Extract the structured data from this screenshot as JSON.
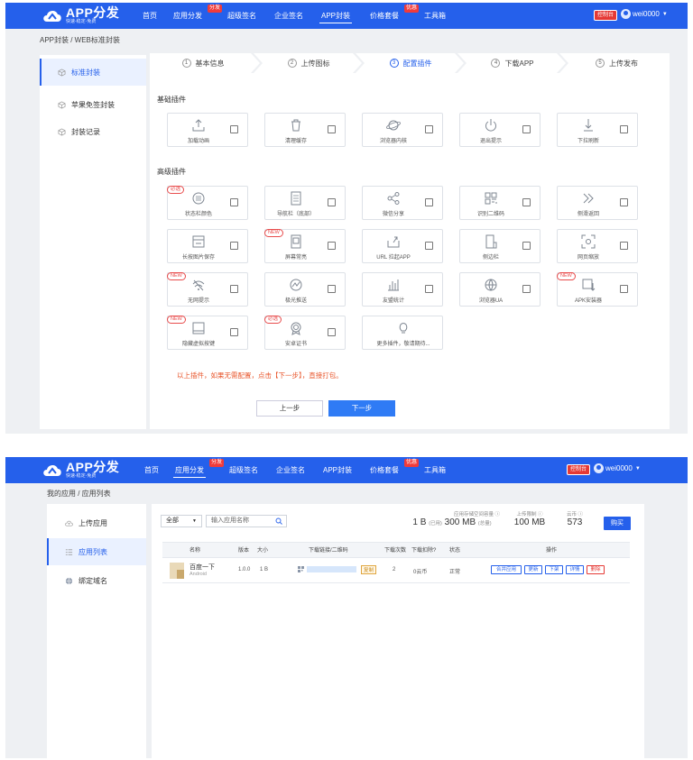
{
  "screen1": {
    "header": {
      "logo_title": "APP分发",
      "logo_sub": "快速-稳定-免费",
      "nav": [
        {
          "label": "首页",
          "tag": ""
        },
        {
          "label": "应用分发",
          "tag": "分发"
        },
        {
          "label": "超级签名",
          "tag": ""
        },
        {
          "label": "企业签名",
          "tag": ""
        },
        {
          "label": "APP封装",
          "tag": ""
        },
        {
          "label": "价格套餐",
          "tag": "优惠"
        },
        {
          "label": "工具箱",
          "tag": ""
        }
      ],
      "active_nav": "APP封装",
      "control_label": "控制台",
      "username": "wei0000"
    },
    "breadcrumb": "APP封装 / WEB标准封装",
    "sidebar": [
      {
        "label": "标准封装",
        "icon": "package-icon"
      },
      {
        "label": "苹果免签封装",
        "icon": "package-icon"
      },
      {
        "label": "封装记录",
        "icon": "package-icon"
      }
    ],
    "steps": [
      {
        "num": "1",
        "label": "基本信息"
      },
      {
        "num": "2",
        "label": "上传图标"
      },
      {
        "num": "3",
        "label": "配置插件"
      },
      {
        "num": "4",
        "label": "下载APP"
      },
      {
        "num": "5",
        "label": "上传发布"
      }
    ],
    "active_step": "3",
    "basic_title": "基础插件",
    "basic_plugins": [
      {
        "label": "加载动画",
        "icon": "upload-icon"
      },
      {
        "label": "清理缓存",
        "icon": "trash-icon"
      },
      {
        "label": "浏览器内核",
        "icon": "planet-icon"
      },
      {
        "label": "退出提示",
        "icon": "power-icon"
      },
      {
        "label": "下拉刷新",
        "icon": "pull-down-icon"
      }
    ],
    "advanced_title": "高级插件",
    "advanced_plugins": [
      {
        "label": "状态栏颜色",
        "icon": "menu-circle-icon",
        "badge": "必选"
      },
      {
        "label": "导航栏（底部）",
        "icon": "document-icon",
        "badge": ""
      },
      {
        "label": "微信分享",
        "icon": "share-icon",
        "badge": ""
      },
      {
        "label": "识别二维码",
        "icon": "qrcode-icon",
        "badge": ""
      },
      {
        "label": "侧滑返回",
        "icon": "double-chevron-icon",
        "badge": ""
      },
      {
        "label": "长按图片保存",
        "icon": "save-image-icon",
        "badge": ""
      },
      {
        "label": "屏幕常亮",
        "icon": "screen-icon",
        "badge": "NEW"
      },
      {
        "label": "URL 拉起APP",
        "icon": "launch-icon",
        "badge": ""
      },
      {
        "label": "侧边栏",
        "icon": "sidebar-icon",
        "badge": ""
      },
      {
        "label": "网页缩放",
        "icon": "zoom-icon",
        "badge": ""
      },
      {
        "label": "无网提示",
        "icon": "wifi-off-icon",
        "badge": "NEW"
      },
      {
        "label": "极光推送",
        "icon": "push-icon",
        "badge": ""
      },
      {
        "label": "友盟统计",
        "icon": "bar-stats-icon",
        "badge": ""
      },
      {
        "label": "浏览器UA",
        "icon": "globe-icon",
        "badge": ""
      },
      {
        "label": "APK安装器",
        "icon": "apk-icon",
        "badge": "NEW"
      },
      {
        "label": "隐藏虚拟按键",
        "icon": "phone-icon",
        "badge": "NEW"
      },
      {
        "label": "安卓证书",
        "icon": "certificate-icon",
        "badge": "必选"
      },
      {
        "label": "更多插件，敬请期待...",
        "icon": "bulb-icon",
        "badge": ""
      }
    ],
    "note": "以上插件，如果无需配置，点击【下一步】，直接打包。",
    "prev_label": "上一步",
    "next_label": "下一步"
  },
  "screen2": {
    "header": {
      "logo_title": "APP分发",
      "logo_sub": "快速-稳定-免费",
      "nav": [
        {
          "label": "首页",
          "tag": ""
        },
        {
          "label": "应用分发",
          "tag": "分发"
        },
        {
          "label": "超级签名",
          "tag": ""
        },
        {
          "label": "企业签名",
          "tag": ""
        },
        {
          "label": "APP封装",
          "tag": ""
        },
        {
          "label": "价格套餐",
          "tag": "优惠"
        },
        {
          "label": "工具箱",
          "tag": ""
        }
      ],
      "active_nav": "应用分发",
      "control_label": "控制台",
      "username": "wei0000"
    },
    "breadcrumb": "我的应用 / 应用列表",
    "sidebar": [
      {
        "label": "上传应用",
        "icon": "cloud-upload-icon"
      },
      {
        "label": "应用列表",
        "icon": "grid-list-icon"
      },
      {
        "label": "绑定域名",
        "icon": "globe-icon"
      }
    ],
    "filter": {
      "select_value": "全部",
      "search_placeholder": "输入应用名称"
    },
    "stats": [
      {
        "caption": "应用存储空间容量",
        "value": "1 B",
        "suffix": "(已用)",
        "value2": "300 MB",
        "suffix2": "(总量)"
      },
      {
        "caption": "上传限制",
        "value": "100 MB"
      },
      {
        "caption": "云币",
        "value": "573"
      }
    ],
    "buy_label": "购买",
    "table": {
      "headers": [
        "名称",
        "版本",
        "大小",
        "下载链接/二维码",
        "下载次数",
        "下载扣除?",
        "状态",
        "操作"
      ],
      "rows": [
        {
          "name": "百度一下",
          "platform": "Android",
          "version": "1.0.0",
          "size": "1 B",
          "link_tag": "复制",
          "downloads": "2",
          "deduct": "0云币",
          "status": "正常",
          "actions": [
            "合并应用",
            "更新",
            "下架",
            "详情",
            "删除"
          ]
        }
      ]
    }
  }
}
